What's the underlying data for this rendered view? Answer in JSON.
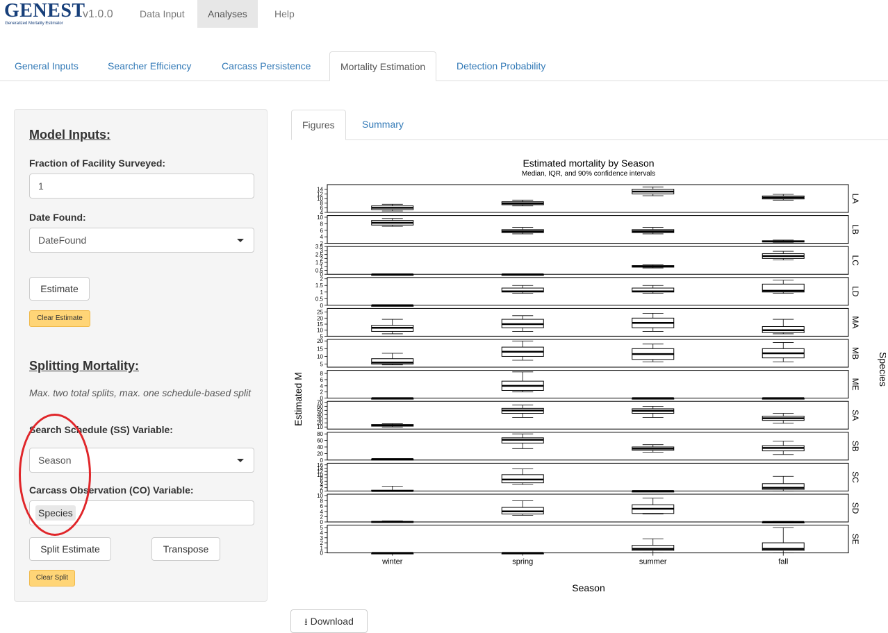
{
  "app": {
    "logo_text": "GENEST",
    "logo_subtitle": "Generalized Mortality Estimator",
    "version": "v1.0.0",
    "nav": [
      "Data Input",
      "Analyses",
      "Help"
    ],
    "nav_active": "Analyses"
  },
  "tabs": [
    "General Inputs",
    "Searcher Efficiency",
    "Carcass Persistence",
    "Mortality Estimation",
    "Detection Probability"
  ],
  "tabs_active": "Mortality Estimation",
  "sidebar": {
    "model_inputs_heading": "Model Inputs:",
    "fraction_label": "Fraction of Facility Surveyed:",
    "fraction_value": "1",
    "date_found_label": "Date Found:",
    "date_found_value": "DateFound",
    "estimate_button": "Estimate",
    "clear_estimate_button": "Clear Estimate",
    "splitting_heading": "Splitting Mortality:",
    "splitting_help": "Max. two total splits, max. one schedule-based split",
    "ss_label": "Search Schedule (SS) Variable:",
    "ss_value": "Season",
    "co_label": "Carcass Observation (CO) Variable:",
    "co_value": "Species",
    "split_estimate_button": "Split Estimate",
    "transpose_button": "Transpose",
    "clear_split_button": "Clear Split"
  },
  "result_tabs": [
    "Figures",
    "Summary"
  ],
  "result_tabs_active": "Figures",
  "download_button": "Download",
  "annotation_color": "#e0262a",
  "chart_data": {
    "type": "boxplot",
    "title": "Estimated mortality by Season",
    "subtitle": "Median, IQR, and 90% confidence intervals",
    "xlabel": "Season",
    "ylabel": "Estimated M",
    "facet_label": "Species",
    "categories": [
      "winter",
      "spring",
      "summer",
      "fall"
    ],
    "panels": [
      {
        "species": "LA",
        "ylim": [
          4,
          16
        ],
        "ticks": [
          4,
          6,
          8,
          10,
          12,
          14
        ],
        "boxes": [
          [
            4.6,
            5.2,
            6.0,
            6.8,
            7.5
          ],
          [
            6.8,
            7.3,
            7.9,
            8.6,
            9.3
          ],
          [
            11.2,
            12.0,
            13.0,
            14.0,
            15.0
          ],
          [
            9.3,
            9.8,
            10.4,
            11.1,
            11.8
          ]
        ]
      },
      {
        "species": "LB",
        "ylim": [
          2,
          10.5
        ],
        "ticks": [
          2,
          4,
          6,
          8,
          10
        ],
        "boxes": [
          [
            7.2,
            7.6,
            8.3,
            9.0,
            9.6
          ],
          [
            4.9,
            5.3,
            5.7,
            6.2,
            6.9
          ],
          [
            4.9,
            5.3,
            5.7,
            6.2,
            6.9
          ],
          [
            2.3,
            2.4,
            2.6,
            2.8,
            3.0
          ]
        ]
      },
      {
        "species": "LC",
        "ylim": [
          0,
          3.5
        ],
        "ticks": [
          0.0,
          0.5,
          1.0,
          1.5,
          2.0,
          2.5,
          3.0,
          3.5
        ],
        "boxes": [
          [
            0,
            0,
            0,
            0,
            0
          ],
          [
            0,
            0,
            0,
            0,
            0
          ],
          [
            0.8,
            0.9,
            1.0,
            1.1,
            1.2
          ],
          [
            1.8,
            2.0,
            2.3,
            2.6,
            2.9
          ]
        ]
      },
      {
        "species": "LD",
        "ylim": [
          0,
          2.1
        ],
        "ticks": [
          0.0,
          0.5,
          1.0,
          1.5,
          2.0
        ],
        "boxes": [
          [
            0,
            0,
            0,
            0,
            0
          ],
          [
            0.9,
            1.0,
            1.05,
            1.3,
            1.5
          ],
          [
            0.9,
            1.0,
            1.05,
            1.3,
            1.5
          ],
          [
            0.9,
            1.0,
            1.1,
            1.6,
            1.9
          ]
        ]
      },
      {
        "species": "MA",
        "ylim": [
          5,
          28
        ],
        "ticks": [
          5,
          10,
          15,
          20,
          25
        ],
        "boxes": [
          [
            7,
            9,
            12,
            14,
            19
          ],
          [
            9,
            12,
            15,
            19,
            22
          ],
          [
            9,
            12,
            16,
            20,
            24
          ],
          [
            7,
            8,
            10,
            13,
            19
          ]
        ]
      },
      {
        "species": "MB",
        "ylim": [
          3,
          21
        ],
        "ticks": [
          5,
          10,
          15,
          20
        ],
        "boxes": [
          [
            4.5,
            5,
            6,
            8.5,
            12
          ],
          [
            7.5,
            10,
            13,
            16,
            20
          ],
          [
            6.5,
            8,
            11.5,
            15,
            18
          ],
          [
            6.5,
            9,
            12,
            15,
            19
          ]
        ]
      },
      {
        "species": "ME",
        "ylim": [
          0,
          9
        ],
        "ticks": [
          0,
          2,
          4,
          6,
          8
        ],
        "boxes": [
          [
            0,
            0,
            0,
            0,
            0
          ],
          [
            2,
            2.5,
            4,
            5.5,
            8.5
          ],
          [
            0,
            0,
            0,
            0,
            0
          ],
          [
            0,
            0,
            0,
            0,
            0
          ]
        ]
      },
      {
        "species": "SA",
        "ylim": [
          5,
          72
        ],
        "ticks": [
          10,
          20,
          30,
          40,
          50,
          60,
          70
        ],
        "boxes": [
          [
            10,
            12,
            14,
            16,
            18
          ],
          [
            33,
            43,
            50,
            55,
            63
          ],
          [
            33,
            43,
            49,
            54,
            60
          ],
          [
            19,
            26,
            31,
            36,
            43
          ]
        ]
      },
      {
        "species": "SB",
        "ylim": [
          0,
          85
        ],
        "ticks": [
          0,
          20,
          40,
          60,
          80
        ],
        "boxes": [
          [
            1,
            2,
            3,
            3,
            4
          ],
          [
            35,
            52,
            62,
            68,
            80
          ],
          [
            24,
            30,
            35,
            40,
            47
          ],
          [
            17,
            28,
            37,
            44,
            58
          ]
        ]
      },
      {
        "species": "SC",
        "ylim": [
          0,
          17
        ],
        "ticks": [
          0,
          2,
          4,
          6,
          8,
          10,
          12,
          14,
          16
        ],
        "boxes": [
          [
            0,
            0,
            0,
            0.5,
            3
          ],
          [
            4,
            5,
            7,
            10,
            13.5
          ],
          [
            0,
            0,
            0,
            0,
            0
          ],
          [
            0,
            1,
            2,
            4.5,
            9
          ]
        ]
      },
      {
        "species": "SD",
        "ylim": [
          0,
          10.5
        ],
        "ticks": [
          0,
          2,
          4,
          6,
          8,
          10
        ],
        "boxes": [
          [
            0,
            0,
            0,
            0.2,
            0.4
          ],
          [
            2.5,
            3,
            4,
            5.5,
            8
          ],
          [
            3,
            3.2,
            5,
            6.5,
            9
          ],
          [
            0,
            0,
            0,
            0,
            0.2
          ]
        ]
      },
      {
        "species": "SE",
        "ylim": [
          0,
          5.5
        ],
        "ticks": [
          0,
          1,
          2,
          3,
          4,
          5
        ],
        "boxes": [
          [
            0,
            0,
            0,
            0,
            0
          ],
          [
            0,
            0,
            0,
            0,
            0
          ],
          [
            0,
            0.5,
            0.8,
            1.5,
            2.8
          ],
          [
            0,
            0.5,
            0.8,
            2,
            5
          ]
        ]
      }
    ]
  }
}
